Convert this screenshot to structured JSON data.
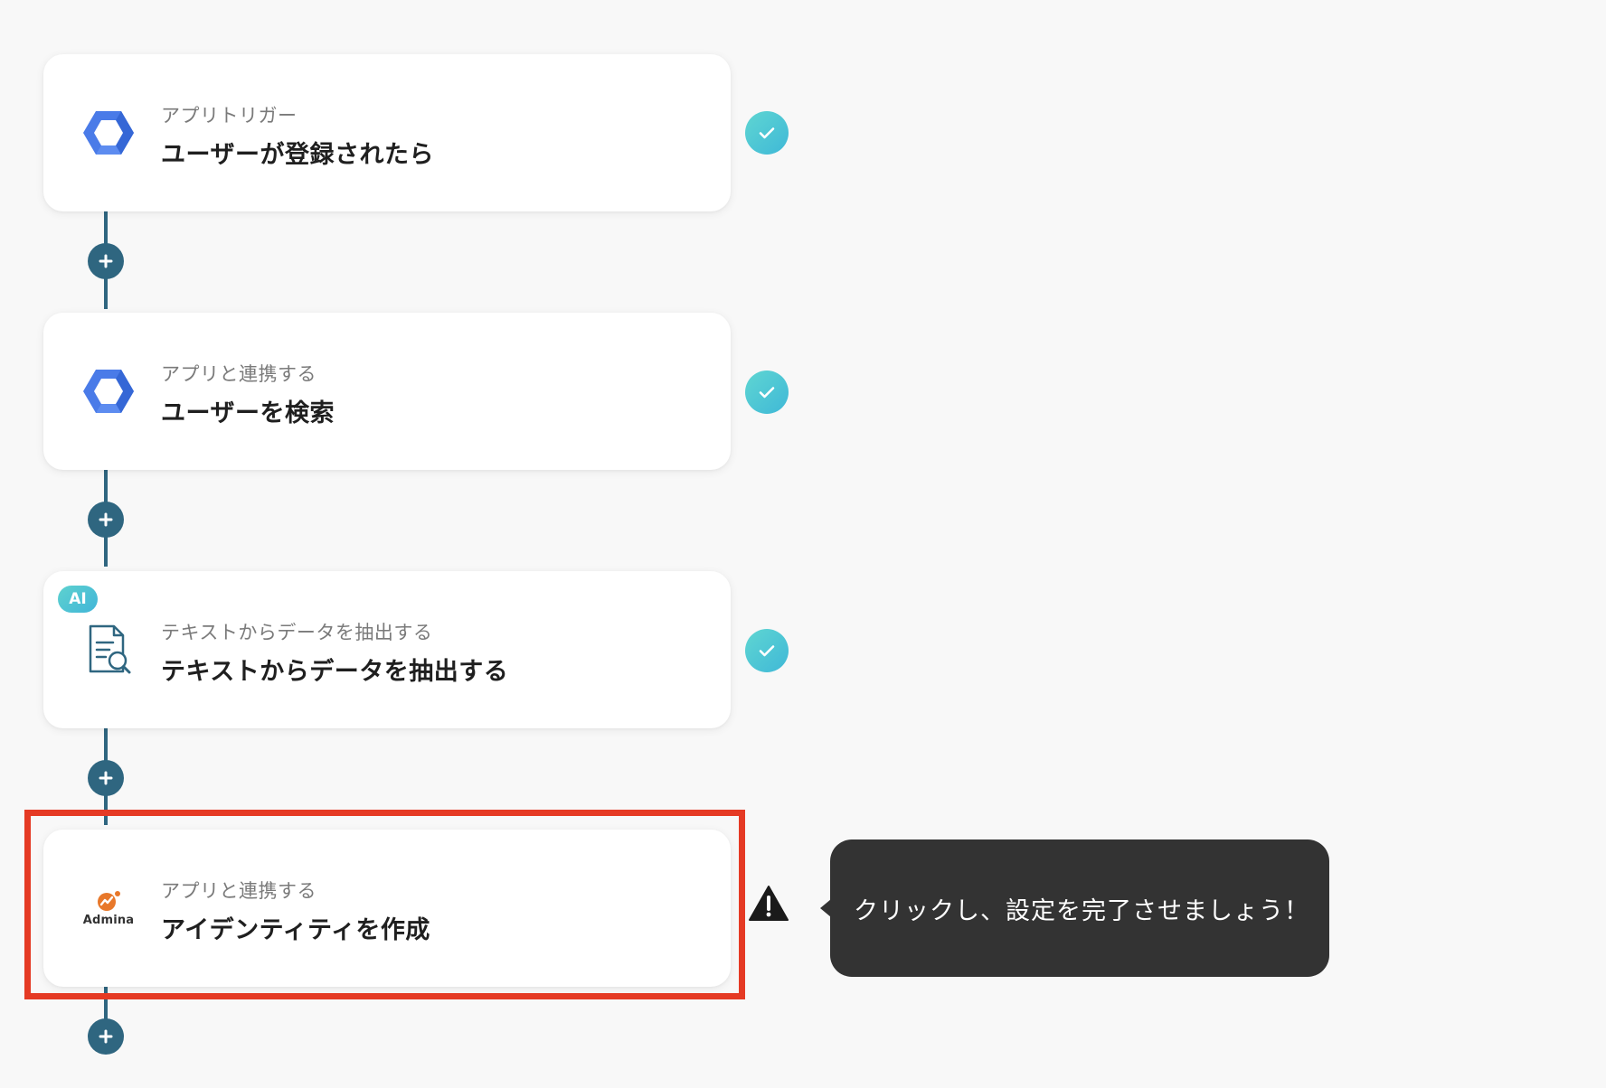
{
  "steps": [
    {
      "label": "アプリトリガー",
      "title": "ユーザーが登録されたら",
      "icon": "google-workspace-icon",
      "status": "complete"
    },
    {
      "label": "アプリと連携する",
      "title": "ユーザーを検索",
      "icon": "google-workspace-icon",
      "status": "complete"
    },
    {
      "label": "テキストからデータを抽出する",
      "title": "テキストからデータを抽出する",
      "icon": "document-search-icon",
      "badge": "AI",
      "status": "complete"
    },
    {
      "label": "アプリと連携する",
      "title": "アイデンティティを作成",
      "icon": "admina-logo",
      "logo_text": "Admina",
      "status": "warning"
    }
  ],
  "tooltip": {
    "text": "クリックし、設定を完了させましょう！"
  },
  "colors": {
    "connector": "#2f6680",
    "check_gradient_start": "#5fd6d2",
    "check_gradient_end": "#3fb8d7",
    "highlight": "#e53a24",
    "tooltip_bg": "#333333",
    "google_blue": "#4a7be8"
  }
}
